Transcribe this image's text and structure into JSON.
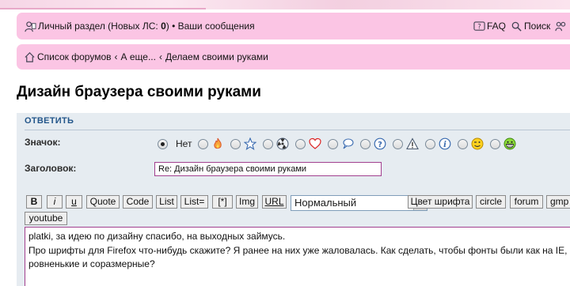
{
  "header": {
    "profile_link": "Личный раздел (Новых ЛС: ",
    "new_pm_count": "0",
    "profile_close": ")",
    "separator": " • ",
    "messages_link": "Ваши сообщения",
    "faq_label": "FAQ",
    "search_label": "Поиск"
  },
  "breadcrumbs": {
    "items": [
      "Список форумов",
      "А еще...",
      "Делаем своими руками"
    ],
    "separator": "‹"
  },
  "topic": {
    "title": "Дизайн браузера своими руками"
  },
  "reply_form": {
    "header": "ОТВЕТИТЬ",
    "icon_label": "Значок:",
    "subject_label": "Заголовок:",
    "subject_value": "Re: Дизайн браузера своими руками",
    "icon_options": [
      {
        "name": "none",
        "label": "Нет",
        "checked": true
      },
      {
        "name": "fire-icon"
      },
      {
        "name": "star-icon"
      },
      {
        "name": "radioactive-icon"
      },
      {
        "name": "heart-icon"
      },
      {
        "name": "speech-bubble-icon"
      },
      {
        "name": "question-icon"
      },
      {
        "name": "warning-icon"
      },
      {
        "name": "info-icon"
      },
      {
        "name": "wink-smiley-icon"
      },
      {
        "name": "grin-smiley-icon"
      }
    ]
  },
  "toolbar": {
    "bold": "B",
    "italic": "i",
    "underline": "u",
    "quote": "Quote",
    "code": "Code",
    "list": "List",
    "list_numbered": "List=",
    "list_item": "[*]",
    "img": "Img",
    "url": "URL",
    "font_size_selected": "Нормальный",
    "font_color": "Цвет шрифта",
    "circle": "circle",
    "forum": "forum",
    "gmp": "gmp",
    "youtube": "youtube"
  },
  "message": {
    "text": "platki, за идею по дизайну спасибо, на выходных займусь.\nПро шрифты для Firefox что-нибудь скажите? Я ранее на них уже жаловалась. Как сделать, чтобы фонты были как на IE, ровненькие и соразмерные?"
  },
  "colors": {
    "navbar_bg": "#fbc5e4",
    "panel_bg": "#e6ecf1",
    "header_blue": "#23568a",
    "input_border": "#a13f8e"
  }
}
